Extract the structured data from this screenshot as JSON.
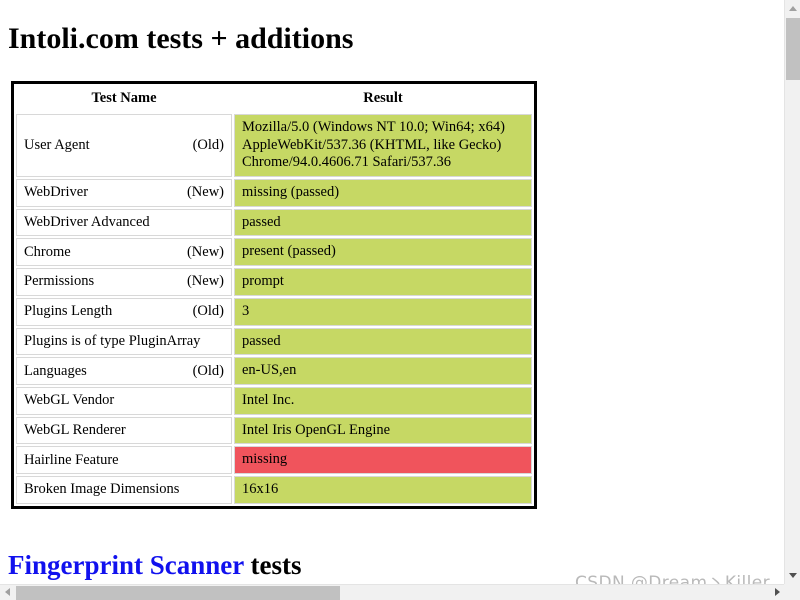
{
  "page": {
    "title": "Intoli.com tests + additions",
    "sub_heading": {
      "link_text": "Fingerprint Scanner",
      "rest_text": " tests"
    },
    "watermark": "CSDN @Dream丶Killer"
  },
  "colors": {
    "pass": "#c6d864",
    "fail": "#f0545c",
    "link": "#1111ee",
    "scrollbar_track": "#f1f1f1",
    "scrollbar_thumb": "#c1c1c1"
  },
  "table": {
    "headers": {
      "name": "Test Name",
      "result": "Result"
    },
    "rows": [
      {
        "name": "User Agent",
        "tag": "(Old)",
        "status": "pass",
        "result_lines": [
          "Mozilla/5.0 (Windows NT 10.0; Win64; x64)",
          "AppleWebKit/537.36 (KHTML, like Gecko)",
          "Chrome/94.0.4606.71 Safari/537.36"
        ]
      },
      {
        "name": "WebDriver",
        "tag": "(New)",
        "status": "pass",
        "result_lines": [
          "missing (passed)"
        ]
      },
      {
        "name": "WebDriver Advanced",
        "tag": "",
        "status": "pass",
        "result_lines": [
          "passed"
        ]
      },
      {
        "name": "Chrome",
        "tag": "(New)",
        "status": "pass",
        "result_lines": [
          "present (passed)"
        ]
      },
      {
        "name": "Permissions",
        "tag": "(New)",
        "status": "pass",
        "result_lines": [
          "prompt"
        ]
      },
      {
        "name": "Plugins Length",
        "tag": "(Old)",
        "status": "pass",
        "result_lines": [
          "3"
        ]
      },
      {
        "name": "Plugins is of type PluginArray",
        "tag": "",
        "status": "pass",
        "result_lines": [
          "passed"
        ]
      },
      {
        "name": "Languages",
        "tag": "(Old)",
        "status": "pass",
        "result_lines": [
          "en-US,en"
        ]
      },
      {
        "name": "WebGL Vendor",
        "tag": "",
        "status": "pass",
        "result_lines": [
          "Intel Inc."
        ]
      },
      {
        "name": "WebGL Renderer",
        "tag": "",
        "status": "pass",
        "result_lines": [
          "Intel Iris OpenGL Engine"
        ]
      },
      {
        "name": "Hairline Feature",
        "tag": "",
        "status": "fail",
        "result_lines": [
          "missing"
        ]
      },
      {
        "name": "Broken Image Dimensions",
        "tag": "",
        "status": "pass",
        "result_lines": [
          "16x16"
        ]
      }
    ]
  },
  "scrollbars": {
    "vertical": {
      "up_arrow_icon": "triangle-up-icon",
      "down_arrow_icon": "triangle-down-icon"
    },
    "horizontal": {
      "left_arrow_icon": "triangle-left-icon",
      "right_arrow_icon": "triangle-right-icon"
    }
  }
}
